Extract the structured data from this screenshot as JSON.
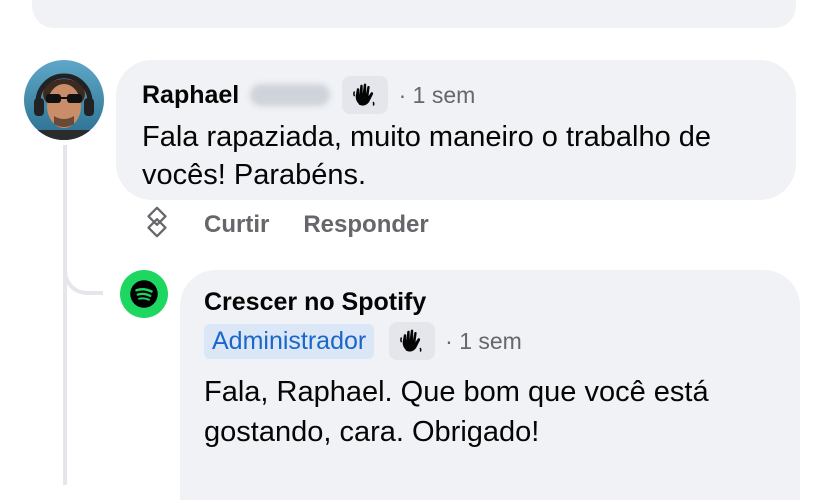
{
  "comment": {
    "author": "Raphael",
    "time": "· 1 sem",
    "text": "Fala rapaziada, muito maneiro o trabalho de vocês! Parabéns.",
    "badge_icon": "waving-hand-icon"
  },
  "actions": {
    "like": "Curtir",
    "reply": "Responder",
    "react_icon": "reaction-icon"
  },
  "reply": {
    "author": "Crescer no Spotify",
    "role_badge": "Administrador",
    "time": "· 1 sem",
    "text": "Fala, Raphael. Que bom que você está gostando, cara. Obrigado!",
    "badge_icon": "waving-hand-icon"
  },
  "colors": {
    "bubble": "#f0f2f5",
    "spotify_green": "#1ed760",
    "admin_badge_bg": "#dbe7f6",
    "admin_badge_text": "#1b66c9",
    "muted": "#65676b"
  }
}
